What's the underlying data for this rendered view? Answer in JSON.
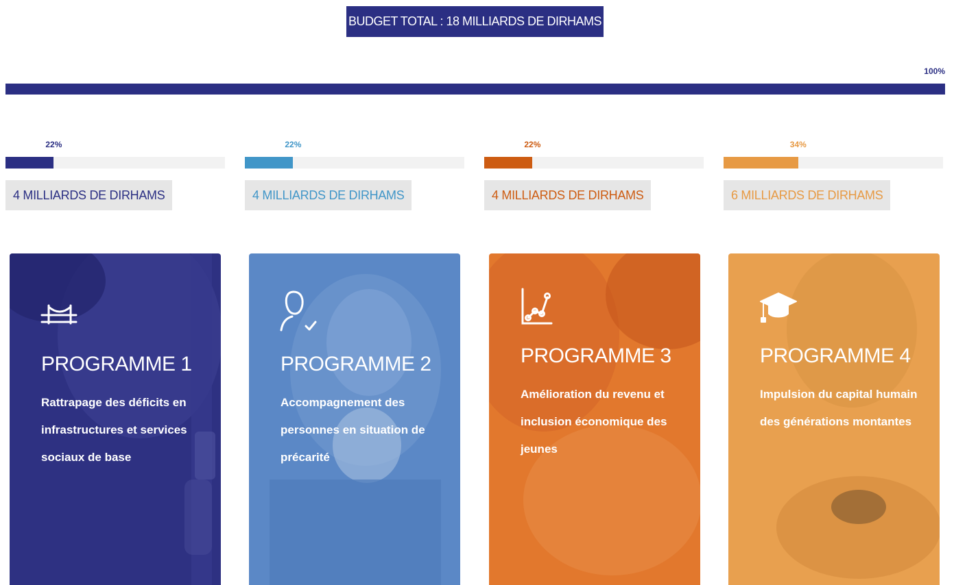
{
  "header": {
    "total_label": "BUDGET TOTAL : 18 MILLIARDS DE DIRHAMS",
    "total_percent": "100%",
    "total_fraction": 1.0,
    "color": "#2b2f83"
  },
  "budgets": [
    {
      "percent_label": "22%",
      "fraction": 0.22,
      "amount": "4 MILLIARDS DE DIRHAMS",
      "color": "#2b2f83"
    },
    {
      "percent_label": "22%",
      "fraction": 0.22,
      "amount": "4 MILLIARDS DE DIRHAMS",
      "color": "#4196c8"
    },
    {
      "percent_label": "22%",
      "fraction": 0.22,
      "amount": "4 MILLIARDS DE DIRHAMS",
      "color": "#cd5c12"
    },
    {
      "percent_label": "34%",
      "fraction": 0.34,
      "amount": "6 MILLIARDS DE DIRHAMS",
      "color": "#e79a44"
    }
  ],
  "programs": [
    {
      "title": "PROGRAMME 1",
      "description": "Rattrapage des déficits en infrastructures et services sociaux de base",
      "icon": "bridge-icon",
      "color": "#2e3182"
    },
    {
      "title": "PROGRAMME 2",
      "description": "Accompagnement des personnes en situation de précarité",
      "icon": "person-check-icon",
      "color": "#5b88c6"
    },
    {
      "title": "PROGRAMME 3",
      "description": "Amélioration du revenu et inclusion économique des jeunes",
      "icon": "chart-icon",
      "color": "#e2782d"
    },
    {
      "title": "PROGRAMME 4",
      "description": "Impulsion du capital humain des générations montantes",
      "icon": "graduation-cap-icon",
      "color": "#e8a04f"
    }
  ]
}
